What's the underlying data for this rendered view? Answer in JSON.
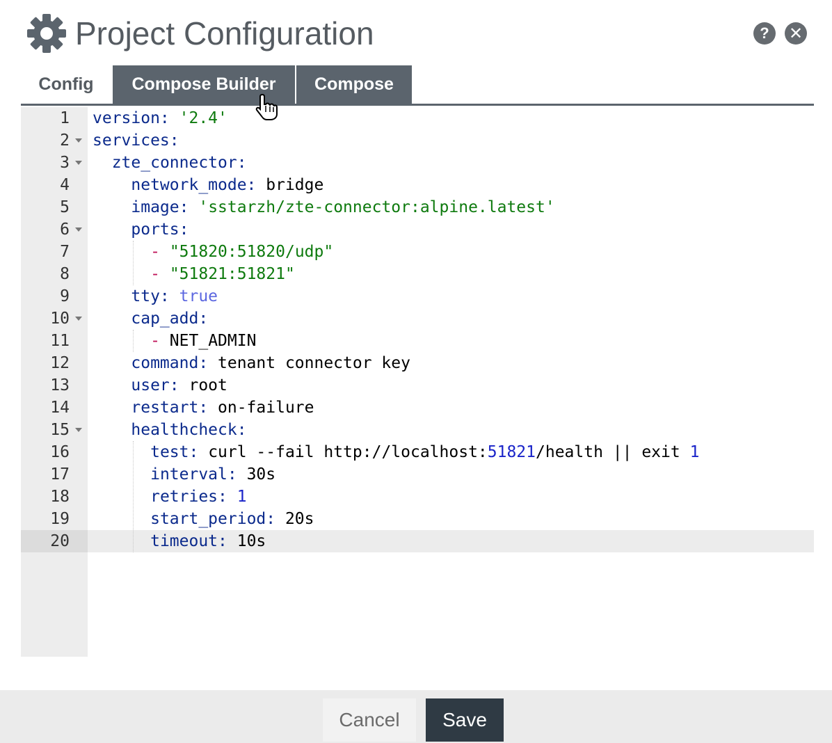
{
  "dialog": {
    "title": "Project Configuration",
    "help_icon": "question-icon",
    "close_icon": "close-icon",
    "help_glyph": "?",
    "close_glyph": "✕"
  },
  "tabs": [
    {
      "label": "Config",
      "active": true
    },
    {
      "label": "Compose Builder",
      "active": false,
      "hovered": true
    },
    {
      "label": "Compose",
      "active": false
    }
  ],
  "editor": {
    "active_line": 20,
    "lines": [
      {
        "num": "1",
        "fold": false,
        "indent": "",
        "parts": [
          {
            "t": "version:",
            "c": "k"
          },
          {
            "t": " ",
            "c": ""
          },
          {
            "t": "'2.4'",
            "c": "s"
          }
        ]
      },
      {
        "num": "2",
        "fold": true,
        "indent": "",
        "parts": [
          {
            "t": "services:",
            "c": "k"
          }
        ]
      },
      {
        "num": "3",
        "fold": true,
        "indent": "  ",
        "parts": [
          {
            "t": "zte_connector:",
            "c": "k"
          }
        ]
      },
      {
        "num": "4",
        "fold": false,
        "indent": "    ",
        "parts": [
          {
            "t": "network_mode:",
            "c": "k"
          },
          {
            "t": " bridge",
            "c": ""
          }
        ]
      },
      {
        "num": "5",
        "fold": false,
        "indent": "    ",
        "parts": [
          {
            "t": "image:",
            "c": "k"
          },
          {
            "t": " ",
            "c": ""
          },
          {
            "t": "'sstarzh/zte-connector:alpine.latest'",
            "c": "s"
          }
        ]
      },
      {
        "num": "6",
        "fold": true,
        "indent": "    ",
        "parts": [
          {
            "t": "ports:",
            "c": "k"
          }
        ]
      },
      {
        "num": "7",
        "fold": false,
        "indent": "      ",
        "parts": [
          {
            "t": "-",
            "c": "d"
          },
          {
            "t": " ",
            "c": ""
          },
          {
            "t": "\"51820:51820/udp\"",
            "c": "s"
          }
        ]
      },
      {
        "num": "8",
        "fold": false,
        "indent": "      ",
        "parts": [
          {
            "t": "-",
            "c": "d"
          },
          {
            "t": " ",
            "c": ""
          },
          {
            "t": "\"51821:51821\"",
            "c": "s"
          }
        ]
      },
      {
        "num": "9",
        "fold": false,
        "indent": "    ",
        "parts": [
          {
            "t": "tty:",
            "c": "k"
          },
          {
            "t": " ",
            "c": ""
          },
          {
            "t": "true",
            "c": "b"
          }
        ]
      },
      {
        "num": "10",
        "fold": true,
        "indent": "    ",
        "parts": [
          {
            "t": "cap_add:",
            "c": "k"
          }
        ]
      },
      {
        "num": "11",
        "fold": false,
        "indent": "      ",
        "parts": [
          {
            "t": "-",
            "c": "d"
          },
          {
            "t": " NET_ADMIN",
            "c": ""
          }
        ]
      },
      {
        "num": "12",
        "fold": false,
        "indent": "    ",
        "parts": [
          {
            "t": "command:",
            "c": "k"
          },
          {
            "t": " tenant connector key",
            "c": ""
          }
        ]
      },
      {
        "num": "13",
        "fold": false,
        "indent": "    ",
        "parts": [
          {
            "t": "user:",
            "c": "k"
          },
          {
            "t": " root",
            "c": ""
          }
        ]
      },
      {
        "num": "14",
        "fold": false,
        "indent": "    ",
        "parts": [
          {
            "t": "restart:",
            "c": "k"
          },
          {
            "t": " on-failure",
            "c": ""
          }
        ]
      },
      {
        "num": "15",
        "fold": true,
        "indent": "    ",
        "parts": [
          {
            "t": "healthcheck:",
            "c": "k"
          }
        ]
      },
      {
        "num": "16",
        "fold": false,
        "indent": "      ",
        "parts": [
          {
            "t": "test:",
            "c": "k"
          },
          {
            "t": " curl --fail http://localhost:",
            "c": ""
          },
          {
            "t": "51821",
            "c": "n"
          },
          {
            "t": "/health || exit ",
            "c": ""
          },
          {
            "t": "1",
            "c": "n"
          }
        ]
      },
      {
        "num": "17",
        "fold": false,
        "indent": "      ",
        "parts": [
          {
            "t": "interval:",
            "c": "k"
          },
          {
            "t": " 30s",
            "c": ""
          }
        ]
      },
      {
        "num": "18",
        "fold": false,
        "indent": "      ",
        "parts": [
          {
            "t": "retries:",
            "c": "k"
          },
          {
            "t": " ",
            "c": ""
          },
          {
            "t": "1",
            "c": "n"
          }
        ]
      },
      {
        "num": "19",
        "fold": false,
        "indent": "      ",
        "parts": [
          {
            "t": "start_period:",
            "c": "k"
          },
          {
            "t": " 20s",
            "c": ""
          }
        ]
      },
      {
        "num": "20",
        "fold": false,
        "indent": "      ",
        "parts": [
          {
            "t": "timeout:",
            "c": "k"
          },
          {
            "t": " 10s",
            "c": ""
          }
        ]
      }
    ]
  },
  "footer": {
    "cancel_label": "Cancel",
    "save_label": "Save"
  },
  "colors": {
    "tab_dark": "#5b646d",
    "save_button": "#2f3a44",
    "yaml_key": "#0b2a8c",
    "yaml_string": "#0e7a0e",
    "yaml_dash": "#c0165a",
    "yaml_bool": "#5c67e0",
    "yaml_number": "#1a24c9"
  }
}
